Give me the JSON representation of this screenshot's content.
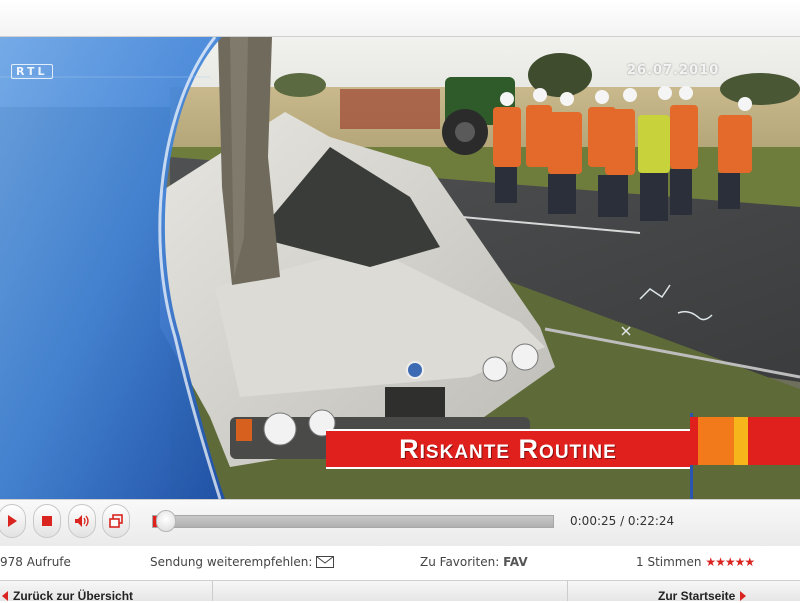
{
  "video": {
    "channel_logo": "RTL",
    "date_overlay": "26.07.2010",
    "title_overlay": "Riskante Routine",
    "accent_colors": [
      "#e0201d",
      "#f27a1a",
      "#f5b51b",
      "#f08a2c",
      "#e0201d"
    ]
  },
  "player": {
    "play_icon": "play-icon",
    "stop_icon": "stop-icon",
    "mute_icon": "speaker-icon",
    "popout_icon": "popout-icon",
    "progress": 0.018,
    "current_time": "0:00:25",
    "duration": "0:22:24",
    "time_display": "0:00:25 / 0:22:24"
  },
  "info": {
    "views": "978 Aufrufe",
    "recommend_label": "Sendung weiterempfehlen:",
    "favorites_label": "Zu Favoriten:",
    "favorites_button": "FAV",
    "votes_label": "1 Stimmen",
    "rating_stars": "★★★★★",
    "rating_value": 5
  },
  "nav": {
    "back_label": "Zurück zur Übersicht",
    "home_label": "Zur Startseite"
  },
  "colors": {
    "accent": "#e0201d",
    "star": "#d9241f"
  }
}
